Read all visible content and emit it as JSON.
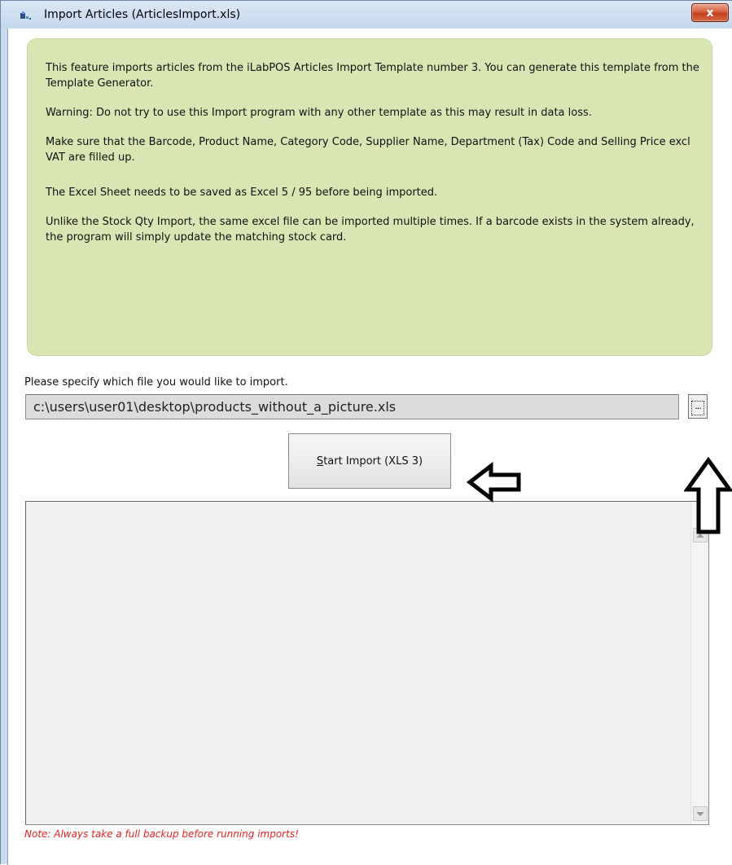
{
  "window": {
    "title": "Import Articles (ArticlesImport.xls)",
    "close_label": "x"
  },
  "info": {
    "p1": "This feature imports articles from the iLabPOS Articles Import Template number 3. You can generate this template from the Template Generator.",
    "p2": "Warning: Do not try to use this Import program with any other template as this may result in data loss.",
    "p3": "Make sure that the Barcode, Product Name, Category Code, Supplier Name, Department (Tax) Code and Selling Price excl VAT are filled up.",
    "p4": "The Excel Sheet needs to be saved as Excel 5 / 95 before being imported.",
    "p5": "Unlike the Stock Qty Import, the same excel file can be imported multiple times. If a barcode exists in the system already, the program will simply update the matching stock card."
  },
  "file": {
    "label": "Please specify which file you would like to import.",
    "value": "c:\\users\\user01\\desktop\\products_without_a_picture.xls",
    "browse_label": "..."
  },
  "import_button": {
    "mnemonic": "S",
    "rest": "tart Import (XLS 3)"
  },
  "note": "Note: Always take a full backup before running imports!",
  "colors": {
    "panel_bg": "#d7e6b3",
    "note_text": "#e8211f",
    "close_button": "#c23d1f"
  }
}
